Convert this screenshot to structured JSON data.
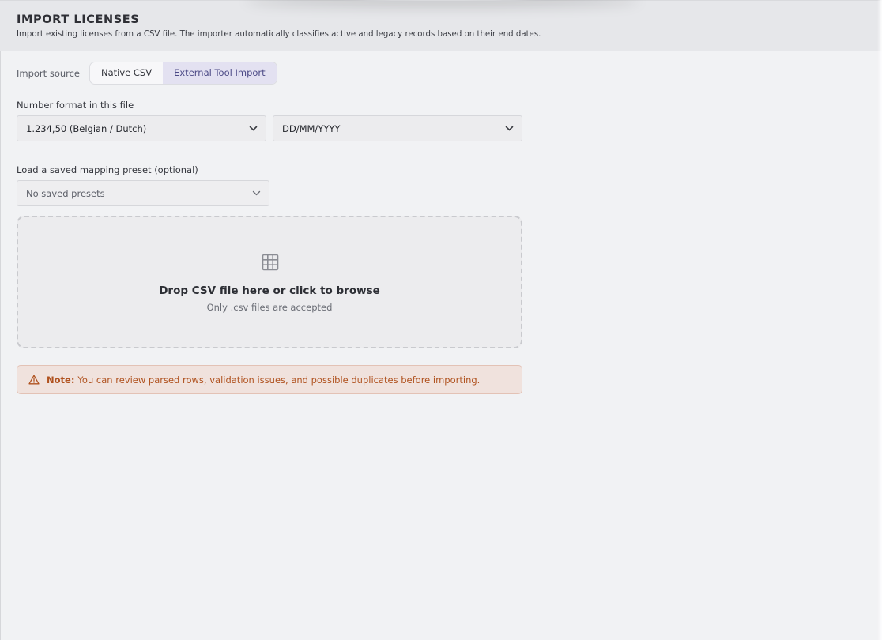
{
  "header": {
    "title": "IMPORT LICENSES",
    "description": "Import existing licenses from a CSV file. The importer automatically classifies active and legacy records based on their end dates."
  },
  "import_source": {
    "label": "Import source",
    "options": [
      "Native CSV",
      "External Tool Import"
    ],
    "selected": "External Tool Import"
  },
  "number_format": {
    "label": "Number format in this file",
    "number_value": "1.234,50 (Belgian / Dutch)",
    "date_value": "DD/MM/YYYY"
  },
  "preset": {
    "label": "Load a saved mapping preset (optional)",
    "value": "No saved presets"
  },
  "dropzone": {
    "icon": "table-grid-icon",
    "title": "Drop CSV file here or click to browse",
    "subtitle": "Only .csv files are accepted"
  },
  "note": {
    "icon": "warning-icon",
    "strong": "Note:",
    "text": "You can review parsed rows, validation issues, and possible duplicates before importing."
  },
  "colors": {
    "accent": "#4c4a86",
    "accent_bg": "#e3e1f1",
    "warning_text": "#b0521f",
    "warning_bg": "#f0e2dd"
  }
}
